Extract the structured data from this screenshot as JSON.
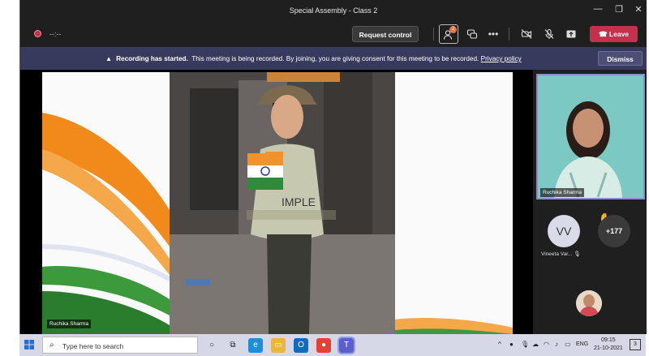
{
  "window": {
    "title": "Special Assembly - Class 2",
    "minimize": "—",
    "restore": "❐",
    "close": "✕"
  },
  "toolbar": {
    "timer": "--:--",
    "request_control": "Request control",
    "people_badge": "2",
    "more": "•••",
    "leave": "Leave"
  },
  "banner": {
    "icon": "▲",
    "bold": "Recording has started.",
    "text": "This meeting is being recorded. By joining, you are giving consent for this meeting to be recorded.",
    "link": "Privacy policy",
    "dismiss": "Dismiss"
  },
  "stage": {
    "presenter_name": "Ruchika Sharma"
  },
  "participants": {
    "thumb_name": "Ruchika Sharma",
    "vv_initials": "VV",
    "vv_name": "Vineeta Var...",
    "more_count": "+177"
  },
  "taskbar": {
    "search_placeholder": "Type here to search",
    "lang": "ENG",
    "time": "09:15",
    "date": "21-10-2021",
    "notif_count": "3"
  },
  "colors": {
    "leave": "#c4314b",
    "banner": "#373a5c",
    "taskbar": "#d6d8e8"
  }
}
